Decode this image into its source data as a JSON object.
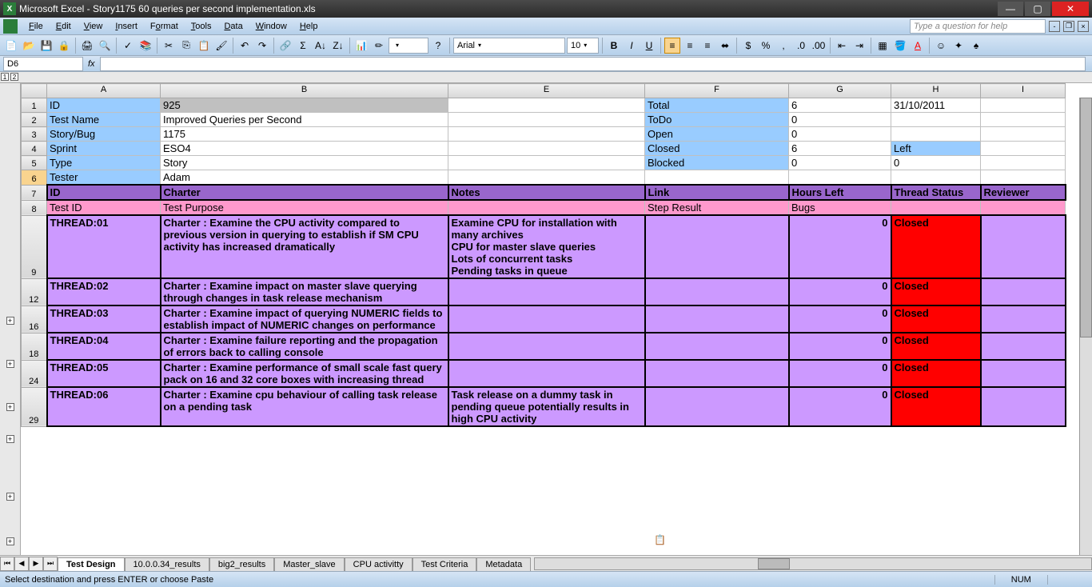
{
  "window": {
    "title": "Microsoft Excel - Story1175 60 queries per second implementation.xls"
  },
  "menu": {
    "file": "File",
    "edit": "Edit",
    "view": "View",
    "insert": "Insert",
    "format": "Format",
    "tools": "Tools",
    "data": "Data",
    "window": "Window",
    "help": "Help",
    "askbox": "Type a question for help"
  },
  "toolbar": {
    "font": "Arial",
    "size": "10"
  },
  "namebox": "D6",
  "columns": [
    "A",
    "B",
    "E",
    "F",
    "G",
    "H",
    "I"
  ],
  "meta": {
    "r1": {
      "a": "ID",
      "b": "925",
      "f": "Total",
      "g": "6",
      "h": "31/10/2011"
    },
    "r2": {
      "a": "Test Name",
      "b": "Improved Queries per Second",
      "f": "ToDo",
      "g": "0"
    },
    "r3": {
      "a": "Story/Bug",
      "b": "1175",
      "f": "Open",
      "g": "0"
    },
    "r4": {
      "a": "Sprint",
      "b": "ESO4",
      "f": "Closed",
      "g": "6",
      "h": "Left"
    },
    "r5": {
      "a": "Type",
      "b": "Story",
      "f": "Blocked",
      "g": "0",
      "h": "0"
    },
    "r6": {
      "a": "Tester",
      "b": "Adam"
    }
  },
  "header7": {
    "a": "ID",
    "b": "Charter",
    "e": "Notes",
    "f": "Link",
    "g": "Hours Left",
    "h": "Thread Status",
    "i": "Reviewer"
  },
  "header8": {
    "a": "Test ID",
    "b": "Test Purpose",
    "f": "Step Result",
    "g": "Bugs"
  },
  "threads": [
    {
      "row": "9",
      "id": "THREAD:01",
      "charter": "Charter : Examine the CPU activity compared to previous version in querying to establish if SM CPU activity has increased dramatically",
      "notes": "Examine CPU for installation with many archives\nCPU for master slave queries\nLots of concurrent tasks\nPending tasks in queue",
      "hours": "0",
      "status": "Closed"
    },
    {
      "row": "12",
      "id": "THREAD:02",
      "charter": "Charter : Examine impact on master slave querying through changes in task release mechanism",
      "notes": "",
      "hours": "0",
      "status": "Closed"
    },
    {
      "row": "16",
      "id": "THREAD:03",
      "charter": "Charter : Examine impact of querying NUMERIC fields to establish impact of NUMERIC changes on performance",
      "notes": "",
      "hours": "0",
      "status": "Closed"
    },
    {
      "row": "18",
      "id": "THREAD:04",
      "charter": "Charter : Examine failure reporting and the propagation of errors back to calling console",
      "notes": "",
      "hours": "0",
      "status": "Closed"
    },
    {
      "row": "24",
      "id": "THREAD:05",
      "charter": "Charter : Examine performance of small scale fast query pack on 16 and 32 core boxes with increasing thread",
      "notes": "",
      "hours": "0",
      "status": "Closed"
    },
    {
      "row": "29",
      "id": "THREAD:06",
      "charter": "Charter : Examine cpu behaviour of calling task release on a pending task",
      "notes": "Task release on a dummy task in pending queue potentially results in high CPU activity",
      "hours": "0",
      "status": "Closed"
    }
  ],
  "tabs": [
    "Test Design",
    "10.0.0.34_results",
    "big2_results",
    "Master_slave",
    "CPU activitty",
    "Test Criteria",
    "Metadata"
  ],
  "active_tab": 0,
  "status": {
    "msg": "Select destination and press ENTER or choose Paste",
    "num": "NUM"
  }
}
